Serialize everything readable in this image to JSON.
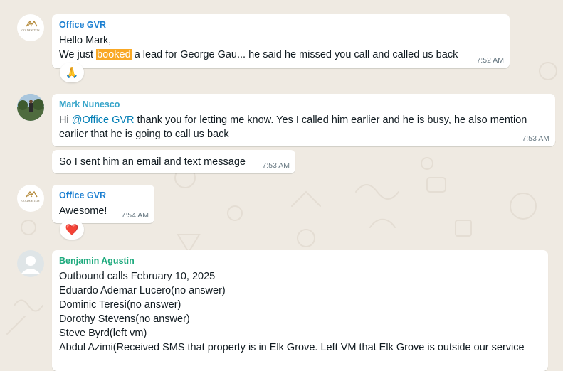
{
  "chat": {
    "messages": [
      {
        "sender": "Office GVR",
        "line1": "Hello Mark,",
        "line2_pre": "We just ",
        "line2_highlight": "booked",
        "line2_post": " a lead for George Gau... he said he missed you call and called us back",
        "time": "7:52 AM",
        "reaction": "🙏"
      },
      {
        "sender": "Mark Nunesco",
        "pre": "Hi ",
        "mention": "@Office GVR",
        "post": " thank you for letting me know. Yes I called him earlier and he is busy, he also mention earlier that he is going to call us back",
        "time": "7:53 AM"
      },
      {
        "text": "So I sent him an email and text message",
        "time": "7:53 AM"
      },
      {
        "sender": "Office GVR",
        "text": "Awesome!",
        "time": "7:54 AM",
        "reaction": "❤️"
      },
      {
        "sender": "Benjamin Agustin",
        "lines": [
          "Outbound calls February 10, 2025",
          "Eduardo Ademar Lucero(no answer)",
          "Dominic Teresi(no answer)",
          "Dorothy Stevens(no answer)",
          "Steve Byrd(left vm)",
          "Abdul Azimi(Received SMS that property is in Elk Grove. Left VM that Elk Grove is outside our service"
        ]
      }
    ]
  },
  "avatars": {
    "office_logo_text": "GOLDENSTEIN"
  },
  "colors": {
    "office_gvr": "#1b7fd1",
    "mark_nunesco": "#35a4c9",
    "benjamin_agustin": "#1daa7d",
    "highlight": "#f9a825",
    "mention": "#027eb5"
  }
}
